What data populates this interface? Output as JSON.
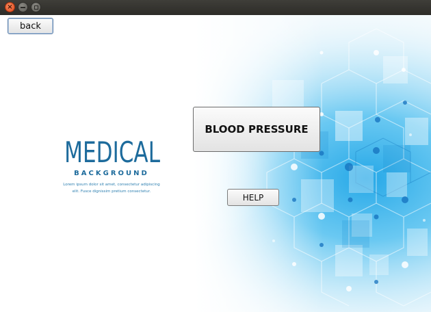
{
  "window": {
    "close_glyph": "×"
  },
  "buttons": {
    "back_label": "back",
    "blood_pressure_label": "BLOOD PRESSURE",
    "help_label": "HELP"
  },
  "logo": {
    "title": "MEDICAL",
    "subtitle": "BACKGROUND",
    "text_line1": "Lorem ipsum dolor sit amet, consectetur adipiscing",
    "text_line2": "elit. Fusce dignissim pretium consectetur."
  },
  "colors": {
    "brand": "#1d6b9c",
    "accent": "#2aa9e0",
    "titlebar": "#3a3935"
  }
}
